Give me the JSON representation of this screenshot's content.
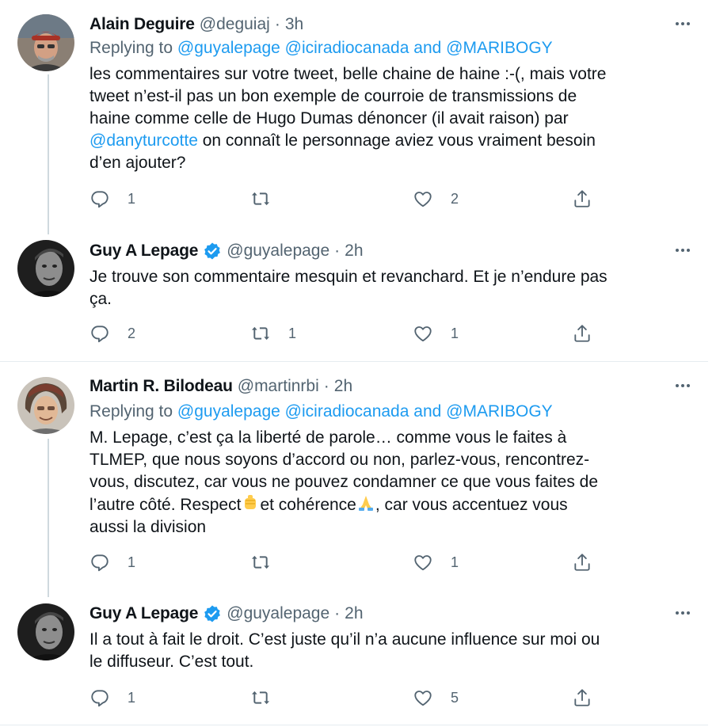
{
  "tweets": [
    {
      "name": "Alain Deguire",
      "handle": "@deguiaj",
      "separator": "·",
      "time": "3h",
      "verified": false,
      "replying_to": {
        "prefix": "Replying to",
        "mentions": [
          "@guyalepage",
          "@iciradiocanada",
          "@MARIBOGY"
        ],
        "conjunction": "and"
      },
      "text_lines": [
        "les commentaires sur votre tweet, belle chaine de haine :-(, mais votre",
        "tweet n’est-il pas un bon exemple de courroie de transmissions de",
        "haine comme celle de Hugo Dumas dénoncer (il avait raison) par",
        "d’en ajouter?"
      ],
      "inline_mention": "@danyturcotte",
      "inline_mention_tail": " on connaît le personnage aviez vous vraiment besoin",
      "counts": {
        "reply": "1",
        "retweet": "",
        "like": "2"
      }
    },
    {
      "name": "Guy A Lepage",
      "handle": "@guyalepage",
      "separator": "·",
      "time": "2h",
      "verified": true,
      "text_lines": [
        "Je trouve son commentaire mesquin et revanchard. Et je n’endure pas",
        "ça."
      ],
      "counts": {
        "reply": "2",
        "retweet": "1",
        "like": "1"
      }
    },
    {
      "name": "Martin R. Bilodeau",
      "handle": "@martinrbi",
      "separator": "·",
      "time": "2h",
      "verified": false,
      "replying_to": {
        "prefix": "Replying to",
        "mentions": [
          "@guyalepage",
          "@iciradiocanada",
          "@MARIBOGY"
        ],
        "conjunction": "and"
      },
      "text_lines": [
        "M. Lepage, c’est ça la liberté de parole… comme vous le faites à",
        "TLMEP, que nous soyons d’accord ou non, parlez-vous, rencontrez-",
        "vous, discutez, car vous ne pouvez condamner ce que vous faites de",
        "aussi la division"
      ],
      "line4_parts": [
        "l’autre côté. Respect",
        "et cohérence",
        ", car vous accentuez vous"
      ],
      "emoji_names": [
        "raised-fist-emoji",
        "folded-hands-emoji"
      ],
      "counts": {
        "reply": "1",
        "retweet": "",
        "like": "1"
      }
    },
    {
      "name": "Guy A Lepage",
      "handle": "@guyalepage",
      "separator": "·",
      "time": "2h",
      "verified": true,
      "text_lines": [
        "Il a tout à fait le droit. C’est juste qu’il n’a aucune influence sur moi ou",
        "le diffuseur. C’est tout."
      ],
      "counts": {
        "reply": "1",
        "retweet": "",
        "like": "5"
      }
    }
  ],
  "icons": [
    "reply-icon",
    "retweet-icon",
    "like-icon",
    "share-icon",
    "more-icon",
    "verified-badge-icon"
  ],
  "colors": {
    "accent": "#1d9bf0",
    "text": "#0f1419",
    "muted": "#536471",
    "separator": "#e6ecf0",
    "thread_line": "#cfd9de"
  }
}
